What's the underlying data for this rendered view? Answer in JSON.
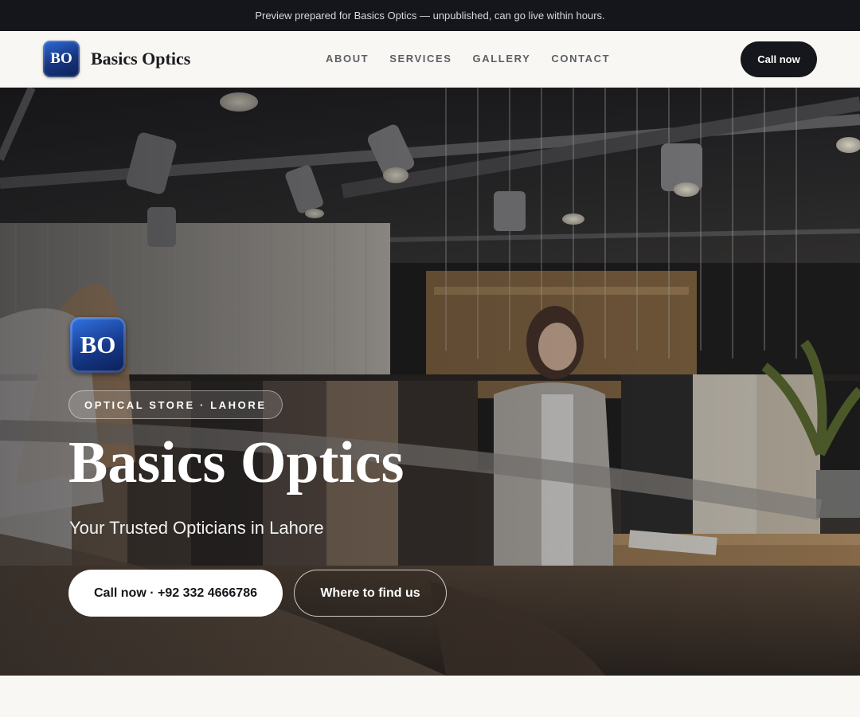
{
  "preview_banner": "Preview prepared for Basics Optics — unpublished, can go live within hours.",
  "header": {
    "logo_text": "BO",
    "brand_name": "Basics Optics",
    "nav": [
      "ABOUT",
      "SERVICES",
      "GALLERY",
      "CONTACT"
    ],
    "call_button": "Call now"
  },
  "hero": {
    "logo_text": "BO",
    "tag": "OPTICAL STORE · LAHORE",
    "title": "Basics Optics",
    "subtitle": "Your Trusted Opticians in Lahore",
    "primary_cta": "Call now · +92 332 4666786",
    "secondary_cta": "Where to find us",
    "background_image": "store-interior-photo"
  },
  "colors": {
    "dark": "#14161b",
    "page_bg": "#f8f7f3",
    "logo_blue": "#16398a"
  }
}
